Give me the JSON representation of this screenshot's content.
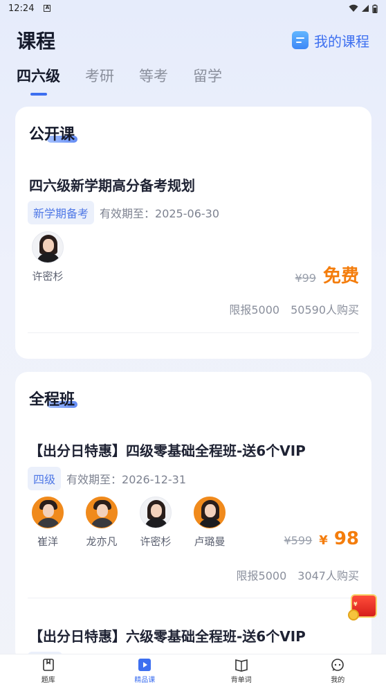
{
  "status": {
    "time": "12:24",
    "notif": "A"
  },
  "header": {
    "title": "课程",
    "my_course_label": "我的课程",
    "my_course_icon": "list-icon"
  },
  "tabs": [
    {
      "label": "四六级",
      "active": true
    },
    {
      "label": "考研",
      "active": false
    },
    {
      "label": "等考",
      "active": false
    },
    {
      "label": "留学",
      "active": false
    }
  ],
  "public_section": {
    "title": "公开课",
    "course": {
      "title": "四六级新学期高分备考规划",
      "tag": "新学期备考",
      "validity": "有效期至：2025-06-30",
      "teachers": [
        {
          "name": "许密杉"
        }
      ],
      "price_original": "¥99",
      "price_current": "免费",
      "limit": "限报5000",
      "buyers": "50590人购买"
    }
  },
  "full_section": {
    "title": "全程班",
    "courses": [
      {
        "title": "【出分日特惠】四级零基础全程班-送6个VIP",
        "tag": "四级",
        "validity": "有效期至：2026-12-31",
        "teachers": [
          {
            "name": "崔洋"
          },
          {
            "name": "龙亦凡"
          },
          {
            "name": "许密杉"
          },
          {
            "name": "卢璐曼"
          }
        ],
        "price_original": "¥599",
        "price_currency": "¥",
        "price_current": "98",
        "limit": "限报5000",
        "buyers": "3047人购买"
      },
      {
        "title": "【出分日特惠】六级零基础全程班-送6个VIP"
      }
    ]
  },
  "float_badge": {
    "icon": "red-packet-icon"
  },
  "bottom_nav": [
    {
      "label": "题库",
      "icon": "question-bank-icon",
      "active": false
    },
    {
      "label": "精品课",
      "icon": "play-icon",
      "active": true
    },
    {
      "label": "背单词",
      "icon": "book-icon",
      "active": false
    },
    {
      "label": "我的",
      "icon": "profile-icon",
      "active": false
    }
  ],
  "colors": {
    "accent": "#3d6ff0",
    "price": "#f47d0c"
  }
}
